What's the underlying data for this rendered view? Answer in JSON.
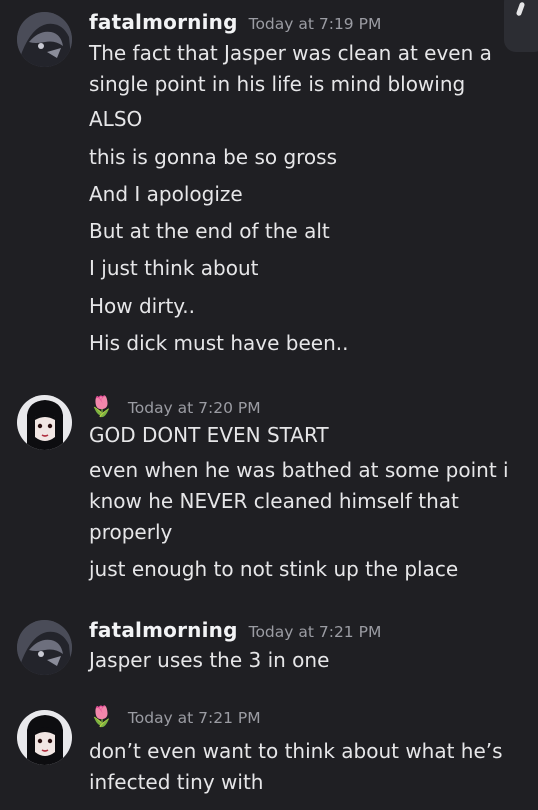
{
  "groups": [
    {
      "username": "fatalmorning",
      "timestamp": "Today at 7:19 PM",
      "messages": [
        "The fact that Jasper was clean at even a single point in his life is mind blowing",
        "ALSO",
        "this is gonna be so gross",
        "And I apologize",
        "But at the end of the alt",
        "I just think about",
        "How dirty..",
        "His dick must have been.."
      ]
    },
    {
      "username": "🌷",
      "timestamp": "Today at 7:20 PM",
      "messages": [
        "GOD DONT EVEN START",
        "even when he was bathed at some point i know he NEVER cleaned himself that properly",
        "just enough to not stink up the place"
      ]
    },
    {
      "username": "fatalmorning",
      "timestamp": "Today at 7:21 PM",
      "messages": [
        "Jasper uses the 3 in one"
      ]
    },
    {
      "username": "🌷",
      "timestamp": "Today at 7:21 PM",
      "messages": [
        "don’t even want to think about what he’s infected tiny with"
      ]
    }
  ]
}
